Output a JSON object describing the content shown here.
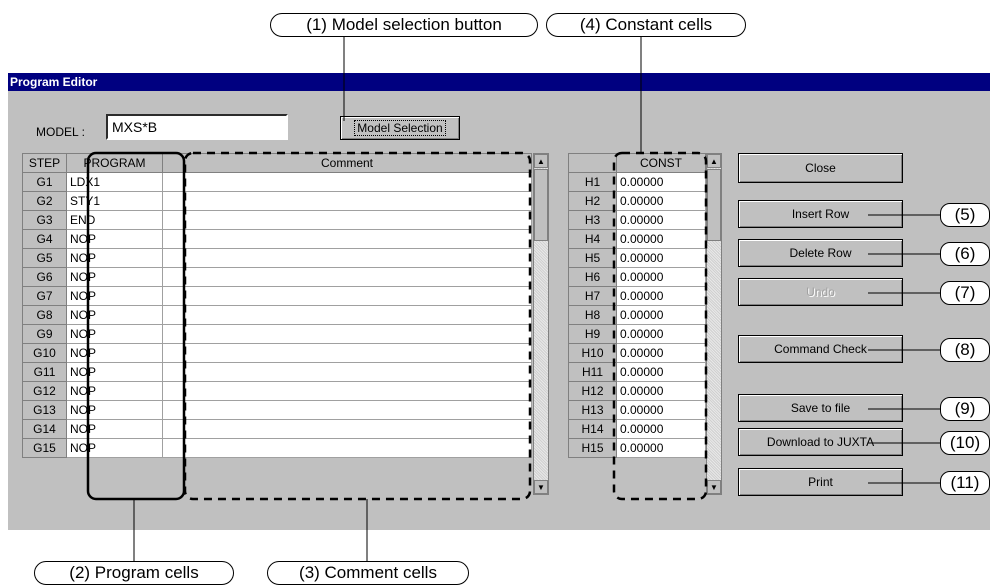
{
  "callouts": {
    "c1": "(1) Model selection button",
    "c2": "(2) Program cells",
    "c3": "(3) Comment cells",
    "c4": "(4) Constant cells",
    "n5": "(5)",
    "n6": "(6)",
    "n7": "(7)",
    "n8": "(8)",
    "n9": "(9)",
    "n10": "(10)",
    "n11": "(11)"
  },
  "window": {
    "title": "Program Editor",
    "model_label": "MODEL :",
    "model_value": "MXS*B",
    "model_button": "Model Selection"
  },
  "program_table": {
    "headers": {
      "step": "STEP",
      "program": "PROGRAM",
      "comment": "Comment"
    },
    "rows": [
      {
        "step": "G1",
        "program": "LDX1"
      },
      {
        "step": "G2",
        "program": "STY1"
      },
      {
        "step": "G3",
        "program": "END"
      },
      {
        "step": "G4",
        "program": "NOP"
      },
      {
        "step": "G5",
        "program": "NOP"
      },
      {
        "step": "G6",
        "program": "NOP"
      },
      {
        "step": "G7",
        "program": "NOP"
      },
      {
        "step": "G8",
        "program": "NOP"
      },
      {
        "step": "G9",
        "program": "NOP"
      },
      {
        "step": "G10",
        "program": "NOP"
      },
      {
        "step": "G11",
        "program": "NOP"
      },
      {
        "step": "G12",
        "program": "NOP"
      },
      {
        "step": "G13",
        "program": "NOP"
      },
      {
        "step": "G14",
        "program": "NOP"
      },
      {
        "step": "G15",
        "program": "NOP"
      }
    ]
  },
  "const_table": {
    "header": "CONST",
    "rows": [
      {
        "h": "H1",
        "v": "0.00000"
      },
      {
        "h": "H2",
        "v": "0.00000"
      },
      {
        "h": "H3",
        "v": "0.00000"
      },
      {
        "h": "H4",
        "v": "0.00000"
      },
      {
        "h": "H5",
        "v": "0.00000"
      },
      {
        "h": "H6",
        "v": "0.00000"
      },
      {
        "h": "H7",
        "v": "0.00000"
      },
      {
        "h": "H8",
        "v": "0.00000"
      },
      {
        "h": "H9",
        "v": "0.00000"
      },
      {
        "h": "H10",
        "v": "0.00000"
      },
      {
        "h": "H11",
        "v": "0.00000"
      },
      {
        "h": "H12",
        "v": "0.00000"
      },
      {
        "h": "H13",
        "v": "0.00000"
      },
      {
        "h": "H14",
        "v": "0.00000"
      },
      {
        "h": "H15",
        "v": "0.00000"
      }
    ]
  },
  "buttons": {
    "close": "Close",
    "insert_row": "Insert Row",
    "delete_row": "Delete Row",
    "undo": "Undo",
    "command_check": "Command Check",
    "save_to_file": "Save to file",
    "download": "Download to JUXTA",
    "print": "Print"
  },
  "colors": {
    "titlebar": "#000080",
    "window_bg": "#c0c0c0"
  }
}
